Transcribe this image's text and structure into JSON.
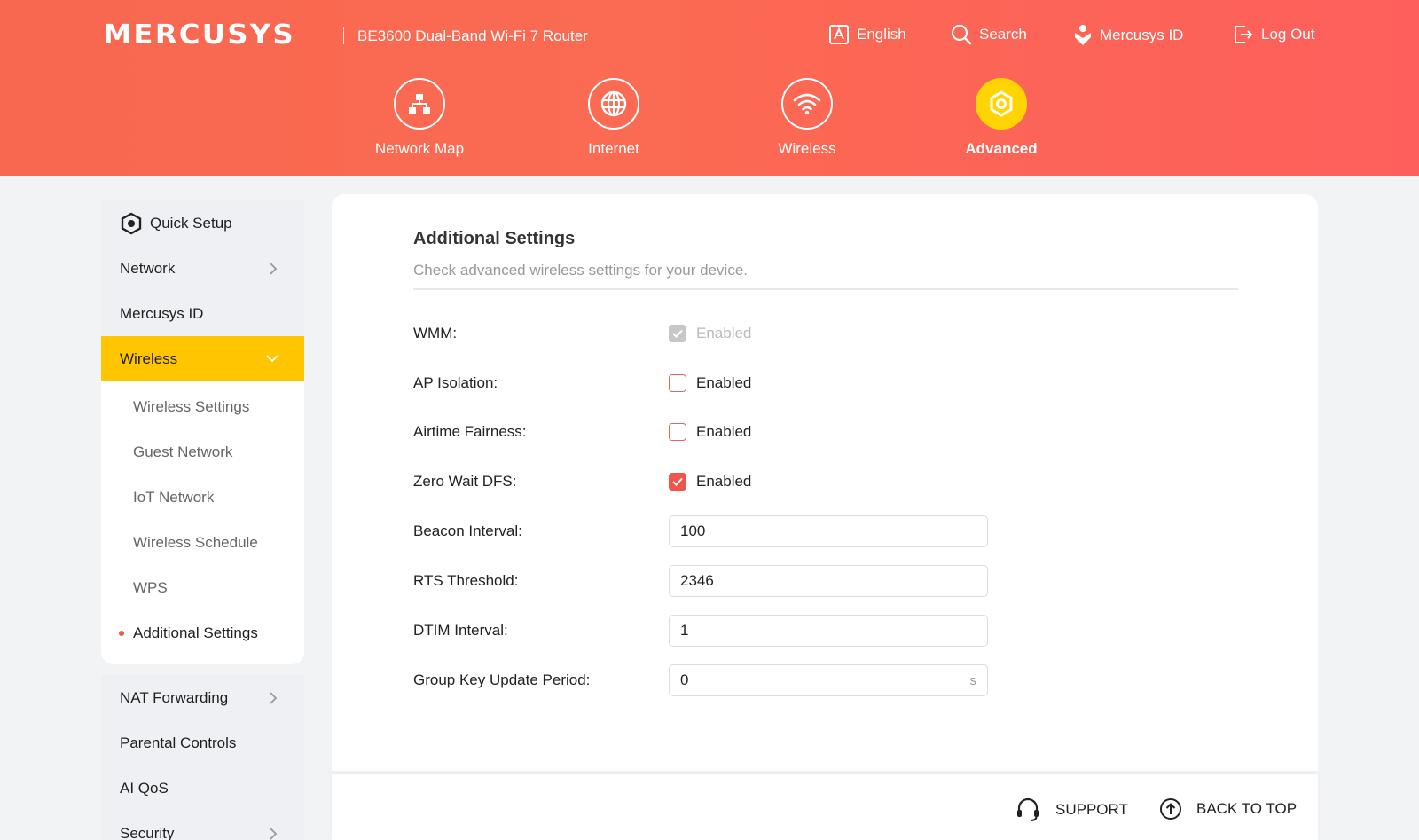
{
  "header": {
    "logo": "MERCUSYS",
    "product": "BE3600 Dual-Band Wi-Fi 7 Router",
    "links": {
      "language": "English",
      "search": "Search",
      "account": "Mercusys ID",
      "logout": "Log Out"
    }
  },
  "nav": {
    "tabs": [
      {
        "label": "Network Map",
        "icon": "network-map-icon"
      },
      {
        "label": "Internet",
        "icon": "globe-icon"
      },
      {
        "label": "Wireless",
        "icon": "wifi-icon"
      },
      {
        "label": "Advanced",
        "icon": "gear-icon",
        "active": true
      }
    ]
  },
  "sidebar": {
    "top_items": [
      {
        "label": "Quick Setup",
        "icon": "quick-setup-gear-icon"
      },
      {
        "label": "Network",
        "expandable": true
      },
      {
        "label": "Mercusys ID"
      }
    ],
    "active": {
      "label": "Wireless",
      "expanded": true
    },
    "sub_items": [
      {
        "label": "Wireless Settings"
      },
      {
        "label": "Guest Network"
      },
      {
        "label": "IoT Network"
      },
      {
        "label": "Wireless Schedule"
      },
      {
        "label": "WPS"
      },
      {
        "label": "Additional Settings",
        "current": true
      }
    ],
    "bottom_items": [
      {
        "label": "NAT Forwarding",
        "expandable": true
      },
      {
        "label": "Parental Controls"
      },
      {
        "label": "AI QoS"
      },
      {
        "label": "Security",
        "expandable": true
      }
    ]
  },
  "main": {
    "title": "Additional Settings",
    "subtitle": "Check advanced wireless settings for your device.",
    "checkbox_rows": [
      {
        "label": "WMM:",
        "option": "Enabled",
        "checked": true,
        "disabled": true
      },
      {
        "label": "AP Isolation:",
        "option": "Enabled",
        "checked": false,
        "disabled": false
      },
      {
        "label": "Airtime Fairness:",
        "option": "Enabled",
        "checked": false,
        "disabled": false
      },
      {
        "label": "Zero Wait DFS:",
        "option": "Enabled",
        "checked": true,
        "disabled": false
      }
    ],
    "input_rows": [
      {
        "label": "Beacon Interval:",
        "value": "100"
      },
      {
        "label": "RTS Threshold:",
        "value": "2346"
      },
      {
        "label": "DTIM Interval:",
        "value": "1"
      },
      {
        "label": "Group Key Update Period:",
        "value": "0",
        "unit": "s"
      }
    ]
  },
  "footer": {
    "support": "SUPPORT",
    "back_to_top": "BACK TO TOP"
  },
  "colors": {
    "header_gradient_start": "#f8674f",
    "header_gradient_end": "#fe5f5c",
    "active_yellow": "#ffc600",
    "checkbox_red": "#f0544a"
  }
}
